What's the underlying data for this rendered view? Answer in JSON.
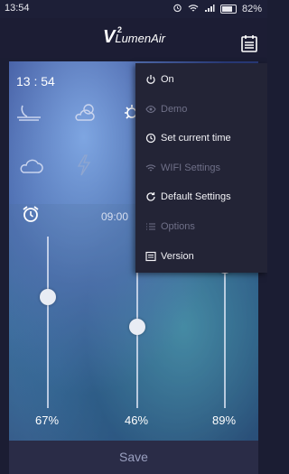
{
  "status_bar": {
    "time": "13:54",
    "battery": "82%"
  },
  "app": {
    "logo_v": "V",
    "logo_sup": "2",
    "logo_name": "LumenAir"
  },
  "clock": {
    "time": "13 : 54"
  },
  "slider_section": {
    "time_value": "09:00"
  },
  "sliders": [
    {
      "label": "67%",
      "level": 67
    },
    {
      "label": "46%",
      "level": 46
    },
    {
      "label": "89%",
      "level": 89
    }
  ],
  "save_label": "Save",
  "menu": {
    "items": [
      {
        "label": "On",
        "icon": "power-icon",
        "enabled": true
      },
      {
        "label": "Demo",
        "icon": "eye-icon",
        "enabled": false
      },
      {
        "label": "Set current time",
        "icon": "clock-icon",
        "enabled": true
      },
      {
        "label": "WIFI Settings",
        "icon": "wifi-icon",
        "enabled": false
      },
      {
        "label": "Default Settings",
        "icon": "refresh-icon",
        "enabled": true
      },
      {
        "label": "Options",
        "icon": "list-icon",
        "enabled": false
      },
      {
        "label": "Version",
        "icon": "info-box-icon",
        "enabled": true
      }
    ]
  },
  "colors": {
    "menu_bg": "#232436",
    "enabled_text": "#f2f2f6",
    "disabled_text": "#6f7088"
  }
}
